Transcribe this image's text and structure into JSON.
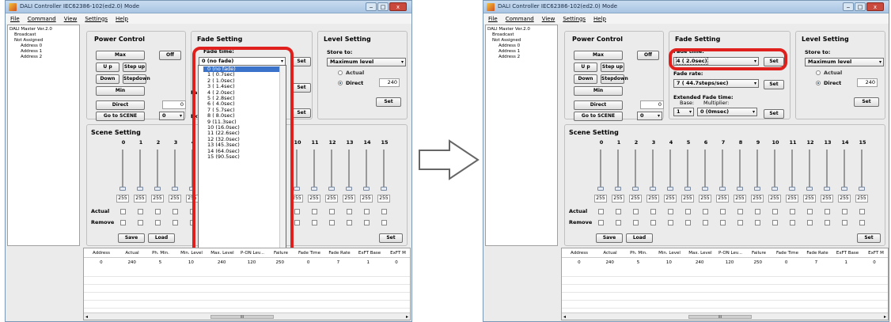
{
  "window": {
    "title": "DALI Controller IEC62386-102(ed2.0) Mode",
    "min_glyph": "‒",
    "max_glyph": "□",
    "close_glyph": "x"
  },
  "menu": [
    "File",
    "Command",
    "View",
    "Settings",
    "Help"
  ],
  "tree": {
    "root": "DALI Master Ver.2.0",
    "broadcast": "Broadcast",
    "not_assigned": "Not Assigned",
    "addresses": [
      "Address 0",
      "Address 1",
      "Address 2"
    ]
  },
  "power_control": {
    "title": "Power Control",
    "max": "Max",
    "off": "Off",
    "up": "U p",
    "step_up": "Step up",
    "down": "Down",
    "step_down": "Stepdown",
    "min": "Min",
    "direct": "Direct",
    "direct_value": "0",
    "go_to_scene": "Go to SCENE",
    "scene_value": "0"
  },
  "fade_setting": {
    "title": "Fade Setting",
    "fade_time_label": "Fade time:",
    "fade_rate_label": "Fade rate:",
    "extended_label": "Extended Fade time:",
    "base_label": "Base:",
    "multiplier_label": "Multiplier:",
    "set": "Set"
  },
  "left_window": {
    "fade_time_value": "0 (no fade)",
    "fade_rate_label_partial": "Fa",
    "extended_label_partial": "Ext"
  },
  "right_window": {
    "fade_time_value": "4 ( 2.0sec)",
    "fade_rate_value": "7 ( 44.7steps/sec)",
    "base_value": "1",
    "multiplier_value": "0 (0msec)"
  },
  "fade_time_options": [
    "0 (no fade)",
    "1 ( 0.7sec)",
    "2 ( 1.0sec)",
    "3 ( 1.4sec)",
    "4 ( 2.0sec)",
    "5 ( 2.8sec)",
    "6 ( 4.0sec)",
    "7 ( 5.7sec)",
    "8 ( 8.0sec)",
    "9 (11.3sec)",
    "10 (16.0sec)",
    "11 (22.6sec)",
    "12 (32.0sec)",
    "13 (45.3sec)",
    "14 (64.0sec)",
    "15 (90.5sec)"
  ],
  "level_setting": {
    "title": "Level Setting",
    "store_to": "Store to:",
    "store_value": "Maximum level",
    "actual": "Actual",
    "direct": "Direct",
    "direct_value": "240",
    "set": "Set"
  },
  "scene_setting": {
    "title": "Scene Setting",
    "channels": [
      "0",
      "1",
      "2",
      "3",
      "4",
      "5",
      "6",
      "7",
      "8",
      "9",
      "10",
      "11",
      "12",
      "13",
      "14",
      "15"
    ],
    "values": [
      "255",
      "255",
      "255",
      "255",
      "255",
      "255",
      "255",
      "255",
      "255",
      "255",
      "255",
      "255",
      "255",
      "255",
      "255",
      "255"
    ],
    "actual_label": "Actual",
    "remove_label": "Remove",
    "save": "Save",
    "load": "Load",
    "set": "Set"
  },
  "table": {
    "headers_left": [
      "Address",
      "Actual",
      "Ph. Min.",
      "Min. Level",
      "Max. Level",
      "P-ON Lev...",
      "Failure",
      "Fade Time",
      "Fade Rate",
      "ExFT Base",
      "ExFT M"
    ],
    "row_left": [
      "0",
      "240",
      "5",
      "10",
      "240",
      "120",
      "250",
      "0",
      "7",
      "1",
      "0"
    ],
    "headers_right": [
      "Address",
      "Actual",
      "Ph. Min.",
      "Min. Level",
      "Max. Level",
      "P-ON Lev...",
      "Failure",
      "Fade Time",
      "Fade Rate",
      "ExFT Base",
      "ExFT M"
    ],
    "row_right": [
      "0",
      "240",
      "5",
      "10",
      "240",
      "120",
      "250",
      "0",
      "7",
      "1",
      "0"
    ],
    "scroll_left": "◂",
    "scroll_right": "▸",
    "scroll_grip": "III"
  },
  "colors": {
    "highlight": "#e0201c",
    "selection": "#3a73c9"
  }
}
